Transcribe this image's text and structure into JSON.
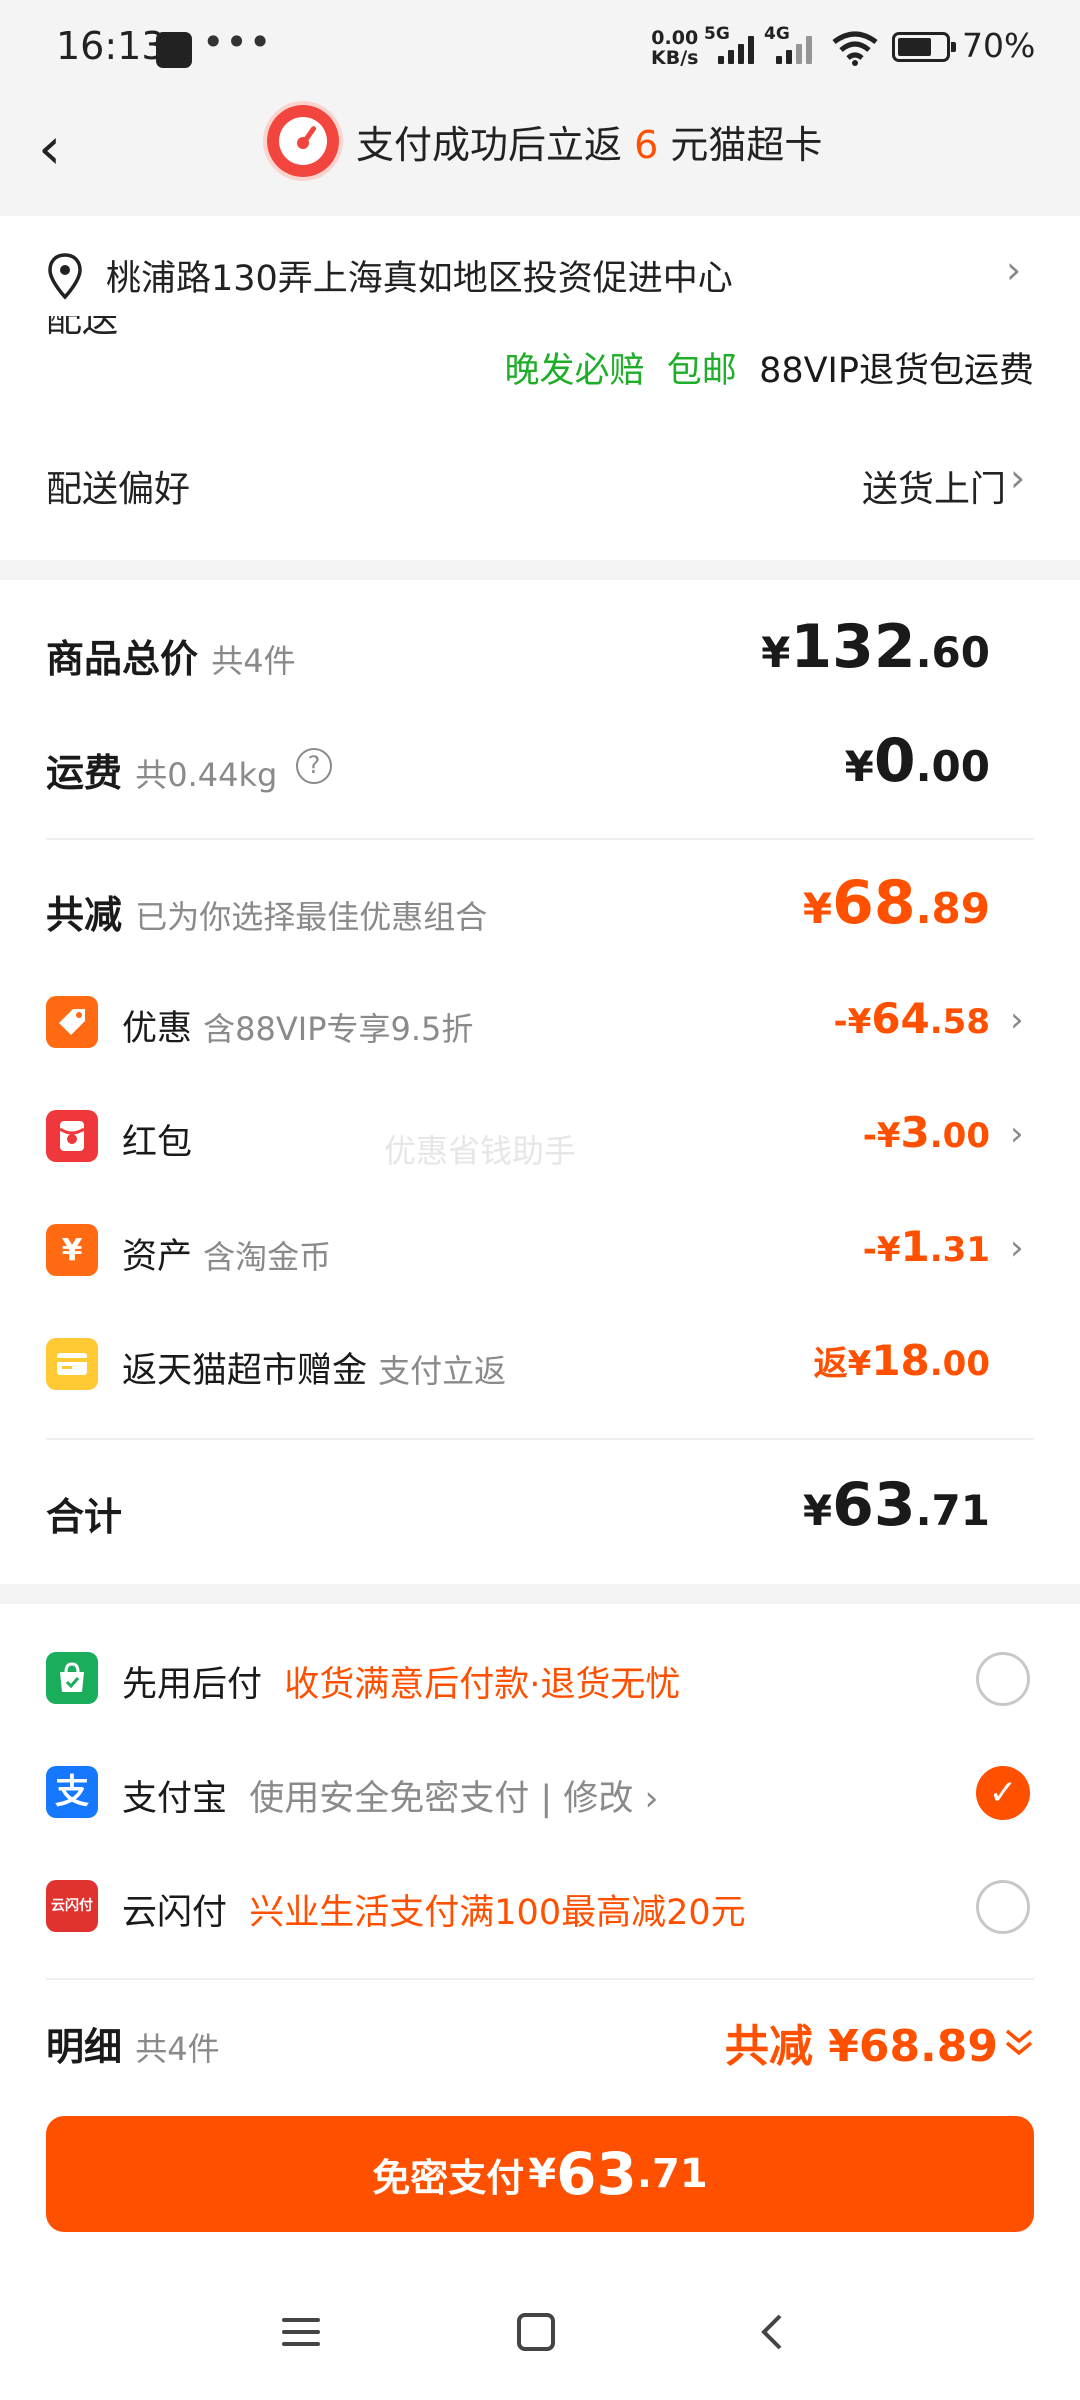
{
  "status_bar": {
    "time": "16:13",
    "more": "•••",
    "speed_value": "0.00",
    "speed_unit": "KB/s",
    "net1": "5G",
    "net2": "4G",
    "battery": "70%"
  },
  "header": {
    "title_prefix": "支付成功后立返",
    "title_number": "6",
    "title_suffix": "元猫超卡"
  },
  "address": {
    "text": "桃浦路130弄上海真如地区投资促进中心"
  },
  "shipping": {
    "label_cut": "配送",
    "tag_late": "晚发必赔",
    "tag_free": "包邮",
    "tag_vip": "88VIP退货包运费"
  },
  "preference": {
    "label": "配送偏好",
    "value": "送货上门"
  },
  "price": {
    "goods_label": "商品总价",
    "goods_count": "共4件",
    "goods_currency": "¥",
    "goods_int": "132",
    "goods_dec": ".60",
    "freight_label": "运费",
    "freight_weight": "共0.44kg",
    "freight_currency": "¥",
    "freight_int": "0",
    "freight_dec": ".00",
    "reduce_label": "共减",
    "reduce_sub": "已为你选择最佳优惠组合",
    "reduce_currency": "¥",
    "reduce_int": "68",
    "reduce_dec": ".89"
  },
  "discounts": [
    {
      "label": "优惠",
      "sub": "含88VIP专享9.5折",
      "prefix": "-¥",
      "int": "64",
      "dec": ".58",
      "icon": "tag-icon",
      "color": "#ff6a13"
    },
    {
      "label": "红包",
      "sub": "",
      "prefix": "-¥",
      "int": "3",
      "dec": ".00",
      "icon": "red-envelope-icon",
      "color": "#f0373b"
    },
    {
      "label": "资产",
      "sub": "含淘金币",
      "prefix": "-¥",
      "int": "1",
      "dec": ".31",
      "icon": "yuan-coin-icon",
      "color": "#ff6a13"
    },
    {
      "label": "返天猫超市赠金",
      "sub": "支付立返",
      "prefix": "返¥",
      "int": "18",
      "dec": ".00",
      "icon": "card-icon",
      "color": "#ffc933"
    }
  ],
  "watermark": "优惠省钱助手",
  "total": {
    "label": "合计",
    "currency": "¥",
    "int": "63",
    "dec": ".71"
  },
  "payment": [
    {
      "name": "先用后付",
      "desc": "收货满意后付款·退货无忧",
      "selected": false,
      "icon": "shopping-bag-icon",
      "color": "#1aad5c"
    },
    {
      "name": "支付宝",
      "desc": "使用安全免密支付 | 修改",
      "selected": true,
      "icon": "alipay-icon",
      "color": "#1677ff"
    },
    {
      "name": "云闪付",
      "desc": "兴业生活支付满100最高减20元",
      "selected": false,
      "icon": "unionpay-quickpass-icon",
      "color": "#e0322e"
    }
  ],
  "unionpay_icon_text": "云闪付",
  "checkmark": "✓",
  "footer": {
    "detail_label": "明细",
    "detail_count": "共4件",
    "detail_reduce": "共减 ¥68.89",
    "btn_text": "免密支付",
    "btn_currency": "¥",
    "btn_int": "63",
    "btn_dec": ".71"
  },
  "colors": {
    "accent": "#ff5000",
    "green": "#1fae2a",
    "bg": "#f4f4f4"
  }
}
